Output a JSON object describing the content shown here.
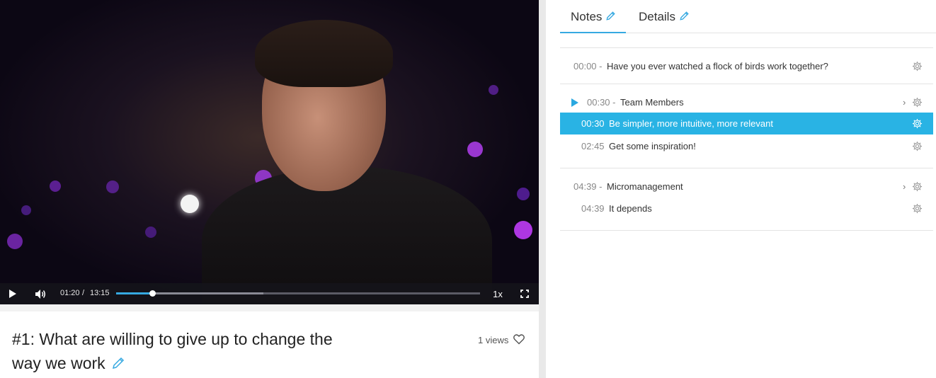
{
  "video": {
    "current_time": "01:20",
    "separator": "/",
    "duration": "13:15",
    "progress_fraction": 0.1006,
    "buffered_fraction": 0.405,
    "speed": "1x"
  },
  "info": {
    "title": "#1: What are willing to give up to change the way we work",
    "views": "1 views"
  },
  "tabs": [
    {
      "label": "Notes"
    },
    {
      "label": "Details"
    }
  ],
  "notes": {
    "sections": [
      {
        "time": "00:00 -",
        "label": "Have you ever watched a flock of birds work together?"
      },
      {
        "time": "00:30 -",
        "label": "Team Members"
      },
      {
        "time": "04:39 -",
        "label": "Micromanagement"
      }
    ],
    "children": [
      {
        "time": "00:30",
        "label": "Be simpler, more intuitive, more relevant"
      },
      {
        "time": "02:45",
        "label": "Get some inspiration!"
      },
      {
        "time": "04:39",
        "label": "It depends"
      }
    ]
  },
  "colors": {
    "accent": "#36a9e1",
    "active_row": "#29b3e4"
  },
  "icons": [
    "play-icon",
    "volume-icon",
    "fullscreen-icon",
    "heart-icon",
    "pencil-icon",
    "gear-icon",
    "chevron-right-icon"
  ]
}
